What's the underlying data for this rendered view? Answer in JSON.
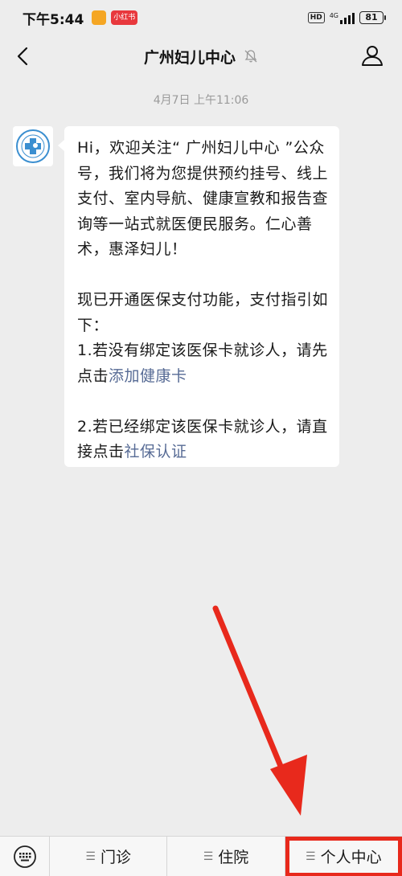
{
  "status_bar": {
    "time": "下午5:44",
    "notif_app_label": "小红书",
    "hd": "HD",
    "network": "4G",
    "battery": "81"
  },
  "header": {
    "title": "广州妇儿中心",
    "icons": {
      "back": "chevron-left-icon",
      "mute": "bell-mute-icon",
      "profile": "person-icon"
    }
  },
  "chat": {
    "timestamp": "4月7日 上午11:06",
    "message": {
      "para1": "Hi，欢迎关注“ 广州妇儿中心 ”公众号，我们将为您提供预约挂号、线上支付、室内导航、健康宣教和报告查询等一站式就医便民服务。仁心善术，惠泽妇儿！",
      "para2": "现已开通医保支付功能，支付指引如下：",
      "para3_prefix": "1.若没有绑定该医保卡就诊人，请先点击",
      "para3_link": "添加健康卡",
      "para4_prefix": "2.若已经绑定该医保卡就诊人，请直接点击",
      "para4_link": "社保认证"
    }
  },
  "bottom_menu": {
    "items": [
      {
        "label": "门诊"
      },
      {
        "label": "住院"
      },
      {
        "label": "个人中心"
      }
    ],
    "highlight_color": "#e8291c"
  },
  "colors": {
    "link": "#576b95",
    "background": "#ededed",
    "annotation": "#e8291c"
  }
}
